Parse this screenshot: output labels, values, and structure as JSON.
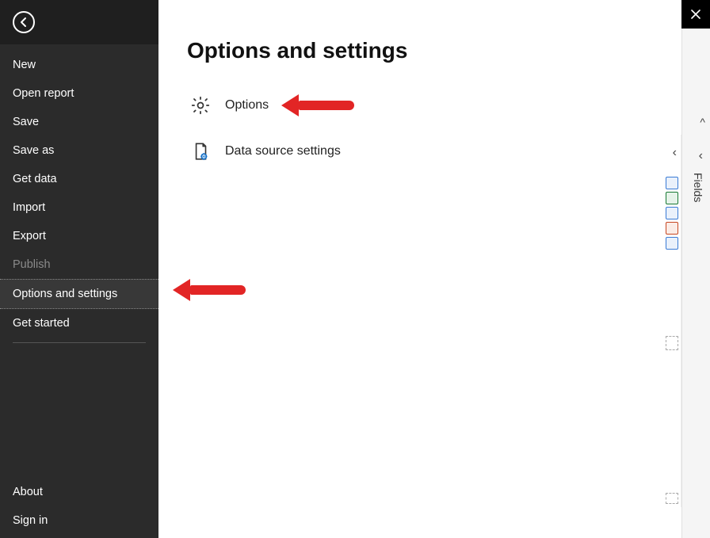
{
  "sidebar": {
    "items": [
      {
        "label": "New"
      },
      {
        "label": "Open report"
      },
      {
        "label": "Save"
      },
      {
        "label": "Save as"
      },
      {
        "label": "Get data"
      },
      {
        "label": "Import"
      },
      {
        "label": "Export"
      },
      {
        "label": "Publish",
        "disabled": true
      },
      {
        "label": "Options and settings",
        "selected": true
      },
      {
        "label": "Get started"
      }
    ],
    "bottom": [
      {
        "label": "About"
      },
      {
        "label": "Sign in"
      }
    ]
  },
  "main": {
    "title": "Options and settings",
    "rows": [
      {
        "label": "Options"
      },
      {
        "label": "Data source settings"
      }
    ]
  },
  "right": {
    "fields_label": "Fields"
  }
}
